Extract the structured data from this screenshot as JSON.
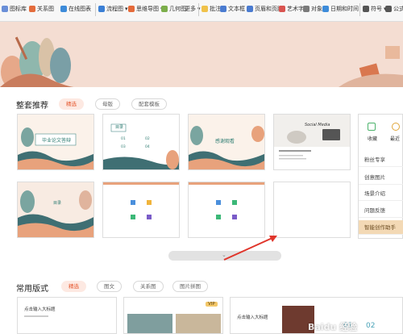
{
  "toolbar": {
    "items": [
      "图标库",
      "关系图",
      "在线图表",
      "流程图",
      "思维导图",
      "几何图",
      "更多",
      "批注",
      "文本框",
      "页眉和页脚",
      "艺术字",
      "对象",
      "日期和时间",
      "符号",
      "公式"
    ]
  },
  "section1": {
    "title": "整套推荐",
    "tabs": [
      "精选",
      "母版",
      "配套模板"
    ],
    "side_items": [
      "收藏",
      "最近",
      "粉丝专享",
      "创意图片",
      "场景介绍",
      "问题反馈",
      "智能创作助手"
    ]
  },
  "slides": {
    "s1_title": "毕业论文答辩",
    "s2_header": "目录",
    "s2_items": [
      "01",
      "02",
      "03",
      "04"
    ],
    "s3_title": "感谢观看",
    "s4_title": "Social Media",
    "s5_title": "目录"
  },
  "section2": {
    "title": "常用版式",
    "tabs": [
      "精选",
      "图文",
      "关系图",
      "图片拼图"
    ],
    "vip_badge": "VIP",
    "card_title": "点击输入大标题",
    "numbers": [
      "01",
      "02"
    ]
  },
  "watermark": "Baidu 经验"
}
